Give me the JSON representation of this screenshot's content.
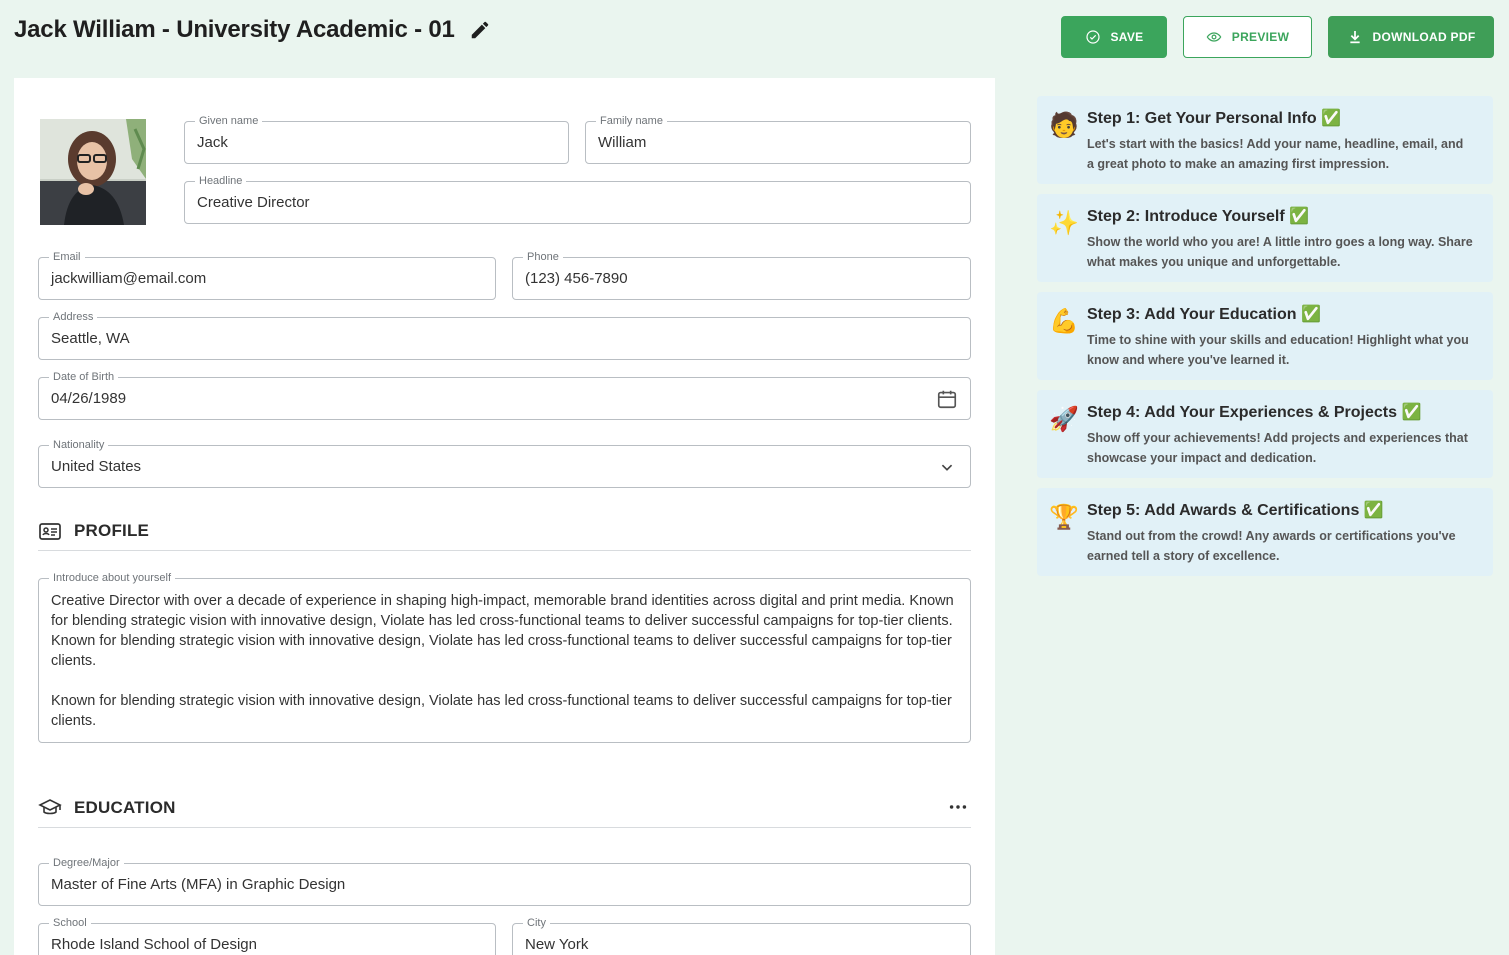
{
  "header": {
    "title": "Jack William - University Academic - 01",
    "save_label": "SAVE",
    "preview_label": "PREVIEW",
    "download_label": "DOWNLOAD PDF"
  },
  "personal": {
    "given_name_label": "Given name",
    "given_name": "Jack",
    "family_name_label": "Family name",
    "family_name": "William",
    "headline_label": "Headline",
    "headline": "Creative Director",
    "email_label": "Email",
    "email": "jackwilliam@email.com",
    "phone_label": "Phone",
    "phone": "(123) 456-7890",
    "address_label": "Address",
    "address": "Seattle, WA",
    "dob_label": "Date of Birth",
    "dob": "04/26/1989",
    "nationality_label": "Nationality",
    "nationality": "United States"
  },
  "profile": {
    "section_title": "PROFILE",
    "intro_label": "Introduce about yourself",
    "paragraphs": [
      "Creative Director with over a decade of experience in shaping high-impact, memorable brand identities across digital and print media. Known for blending strategic vision with innovative design, Violate has led cross-functional teams to deliver successful campaigns for top-tier clients. Known for blending strategic vision with innovative design, Violate has led cross-functional teams to deliver successful campaigns for top-tier clients.",
      "Known for blending strategic vision with innovative design, Violate has led cross-functional teams to deliver successful campaigns for top-tier clients."
    ]
  },
  "education": {
    "section_title": "EDUCATION",
    "degree_label": "Degree/Major",
    "degree": "Master of Fine Arts (MFA) in Graphic Design",
    "school_label": "School",
    "school": "Rhode Island School of Design",
    "city_label": "City",
    "city": "New York"
  },
  "steps": [
    {
      "emoji": "🧑",
      "title": "Step 1: Get Your Personal Info ✅",
      "desc": "Let's start with the basics! Add your name, headline, email, and a great photo to make an amazing first impression."
    },
    {
      "emoji": "✨",
      "title": "Step 2: Introduce Yourself ✅",
      "desc": "Show the world who you are! A little intro goes a long way. Share what makes you unique and unforgettable."
    },
    {
      "emoji": "💪",
      "title": "Step 3: Add Your Education ✅",
      "desc": "Time to shine with your skills and education! Highlight what you know and where you've learned it."
    },
    {
      "emoji": "🚀",
      "title": "Step 4: Add Your Experiences & Projects ✅",
      "desc": "Show off your achievements! Add projects and experiences that showcase your impact and dedication."
    },
    {
      "emoji": "🏆",
      "title": "Step 5: Add Awards & Certifications ✅",
      "desc": "Stand out from the crowd! Any awards or certifications you've earned tell a story of excellence."
    }
  ],
  "colors": {
    "accent": "#3ba55c",
    "page_bg": "#eaf5ef",
    "step_bg": "#e1f1f7"
  }
}
